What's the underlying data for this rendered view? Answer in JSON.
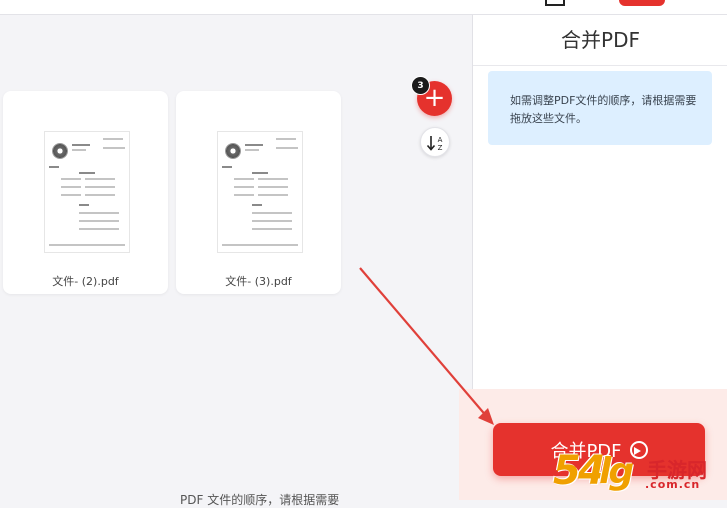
{
  "sidebar": {
    "title": "合并PDF",
    "info_text": "如需调整PDF文件的顺序，请根据需要拖放这些文件。"
  },
  "files": [
    {
      "name": "文件- (2).pdf"
    },
    {
      "name": "文件- (3).pdf"
    }
  ],
  "toolbar": {
    "file_count": "3",
    "add_icon": "plus-icon",
    "sort_icon": "sort-az-icon"
  },
  "merge_button": {
    "label": "合并PDF",
    "icon": "arrow-circle-right-icon"
  },
  "watermark": {
    "number": "54",
    "slash": "lg",
    "text": "手游网",
    "domain": ".com.cn"
  },
  "bottom_snippet": "PDF 文件的顺序，请根据需要",
  "colors": {
    "accent": "#e5322d",
    "info_bg": "#ddefff",
    "panel_bg": "#fdebe8",
    "workspace_bg": "#f4f4f7"
  }
}
